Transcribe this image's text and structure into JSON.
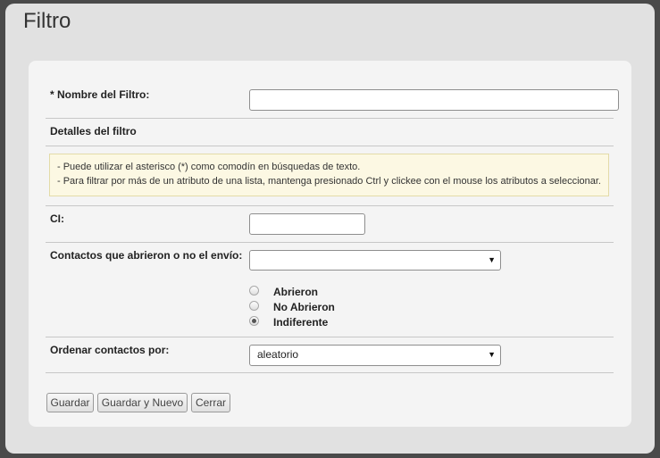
{
  "page": {
    "title": "Filtro"
  },
  "form": {
    "filter_name_label": "* Nombre del Filtro:",
    "filter_name_value": "",
    "details_heading": "Detalles del filtro",
    "notice_lines": [
      "- Puede utilizar el asterisco (*) como comodín en búsquedas de texto.",
      "- Para filtrar por más de un atributo de una lista, mantenga presionado Ctrl y clickee con el mouse los atributos a seleccionar."
    ],
    "ci_label": "CI:",
    "ci_value": "",
    "opened_label": "Contactos que abrieron o no el envío:",
    "opened_select_value": "",
    "opened_options": [
      {
        "label": "Abrieron",
        "checked": false
      },
      {
        "label": "No Abrieron",
        "checked": false
      },
      {
        "label": "Indiferente",
        "checked": true
      }
    ],
    "sort_label": "Ordenar contactos por:",
    "sort_value": "aleatorio"
  },
  "buttons": {
    "save": "Guardar",
    "save_new": "Guardar y Nuevo",
    "close": "Cerrar"
  },
  "icons": {
    "select_arrow": "chevron-down-icon"
  },
  "colors": {
    "notice_bg": "#fcf8e3",
    "panel_bg": "#f4f4f4",
    "window_bg": "#e1e1e1"
  }
}
